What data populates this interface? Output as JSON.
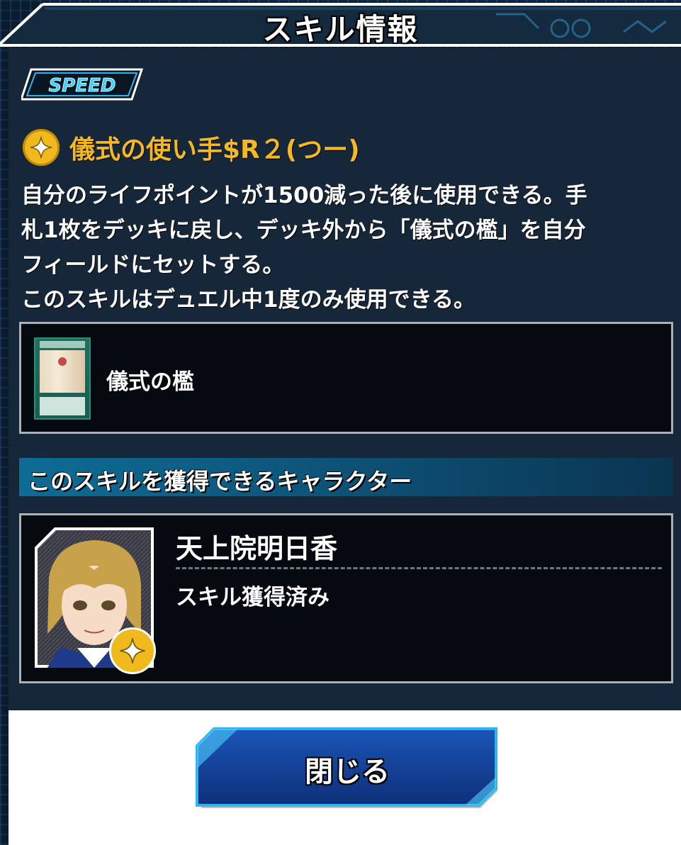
{
  "dialog": {
    "title": "スキル情報",
    "speed_badge_text": "SPEED"
  },
  "skill": {
    "icon": "sparkle-star-icon",
    "name": "儀式の使い手$R２(つー)",
    "description_lines": [
      "自分のライフポイントが1500減った後に使用できる。手",
      "札1枚をデッキに戻し、デッキ外から「儀式の檻」を自分",
      "フィールドにセットする。",
      "このスキルはデュエル中1度のみ使用できる。"
    ]
  },
  "related_card": {
    "name": "儀式の檻",
    "thumbnail": "card-thumbnail"
  },
  "characters_section": {
    "header": "このスキルを獲得できるキャラクター",
    "characters": [
      {
        "name": "天上院明日香",
        "status": "スキル獲得済み",
        "portrait": "character-portrait",
        "badge_icon": "sparkle-star-icon"
      }
    ]
  },
  "footer": {
    "close_label": "閉じる"
  },
  "colors": {
    "panel_bg": "#16273a",
    "skill_name": "#f5b820",
    "section_header": "#0e6c95",
    "button_blue": "#1848a8",
    "button_border": "#2fb4f0"
  }
}
